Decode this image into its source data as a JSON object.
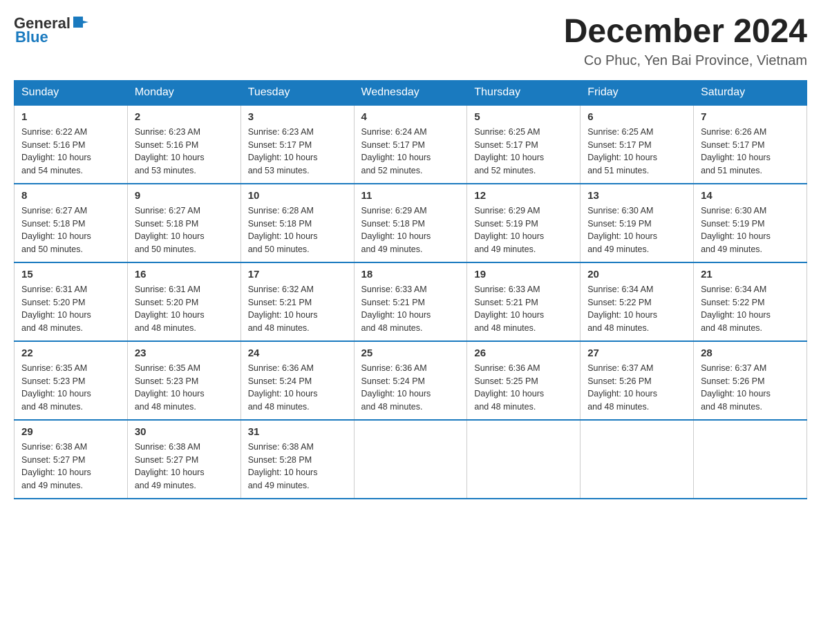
{
  "header": {
    "logo_general": "General",
    "logo_blue": "Blue",
    "title": "December 2024",
    "location": "Co Phuc, Yen Bai Province, Vietnam"
  },
  "days_of_week": [
    "Sunday",
    "Monday",
    "Tuesday",
    "Wednesday",
    "Thursday",
    "Friday",
    "Saturday"
  ],
  "weeks": [
    [
      {
        "day": "1",
        "sunrise": "6:22 AM",
        "sunset": "5:16 PM",
        "daylight": "10 hours and 54 minutes."
      },
      {
        "day": "2",
        "sunrise": "6:23 AM",
        "sunset": "5:16 PM",
        "daylight": "10 hours and 53 minutes."
      },
      {
        "day": "3",
        "sunrise": "6:23 AM",
        "sunset": "5:17 PM",
        "daylight": "10 hours and 53 minutes."
      },
      {
        "day": "4",
        "sunrise": "6:24 AM",
        "sunset": "5:17 PM",
        "daylight": "10 hours and 52 minutes."
      },
      {
        "day": "5",
        "sunrise": "6:25 AM",
        "sunset": "5:17 PM",
        "daylight": "10 hours and 52 minutes."
      },
      {
        "day": "6",
        "sunrise": "6:25 AM",
        "sunset": "5:17 PM",
        "daylight": "10 hours and 51 minutes."
      },
      {
        "day": "7",
        "sunrise": "6:26 AM",
        "sunset": "5:17 PM",
        "daylight": "10 hours and 51 minutes."
      }
    ],
    [
      {
        "day": "8",
        "sunrise": "6:27 AM",
        "sunset": "5:18 PM",
        "daylight": "10 hours and 50 minutes."
      },
      {
        "day": "9",
        "sunrise": "6:27 AM",
        "sunset": "5:18 PM",
        "daylight": "10 hours and 50 minutes."
      },
      {
        "day": "10",
        "sunrise": "6:28 AM",
        "sunset": "5:18 PM",
        "daylight": "10 hours and 50 minutes."
      },
      {
        "day": "11",
        "sunrise": "6:29 AM",
        "sunset": "5:18 PM",
        "daylight": "10 hours and 49 minutes."
      },
      {
        "day": "12",
        "sunrise": "6:29 AM",
        "sunset": "5:19 PM",
        "daylight": "10 hours and 49 minutes."
      },
      {
        "day": "13",
        "sunrise": "6:30 AM",
        "sunset": "5:19 PM",
        "daylight": "10 hours and 49 minutes."
      },
      {
        "day": "14",
        "sunrise": "6:30 AM",
        "sunset": "5:19 PM",
        "daylight": "10 hours and 49 minutes."
      }
    ],
    [
      {
        "day": "15",
        "sunrise": "6:31 AM",
        "sunset": "5:20 PM",
        "daylight": "10 hours and 48 minutes."
      },
      {
        "day": "16",
        "sunrise": "6:31 AM",
        "sunset": "5:20 PM",
        "daylight": "10 hours and 48 minutes."
      },
      {
        "day": "17",
        "sunrise": "6:32 AM",
        "sunset": "5:21 PM",
        "daylight": "10 hours and 48 minutes."
      },
      {
        "day": "18",
        "sunrise": "6:33 AM",
        "sunset": "5:21 PM",
        "daylight": "10 hours and 48 minutes."
      },
      {
        "day": "19",
        "sunrise": "6:33 AM",
        "sunset": "5:21 PM",
        "daylight": "10 hours and 48 minutes."
      },
      {
        "day": "20",
        "sunrise": "6:34 AM",
        "sunset": "5:22 PM",
        "daylight": "10 hours and 48 minutes."
      },
      {
        "day": "21",
        "sunrise": "6:34 AM",
        "sunset": "5:22 PM",
        "daylight": "10 hours and 48 minutes."
      }
    ],
    [
      {
        "day": "22",
        "sunrise": "6:35 AM",
        "sunset": "5:23 PM",
        "daylight": "10 hours and 48 minutes."
      },
      {
        "day": "23",
        "sunrise": "6:35 AM",
        "sunset": "5:23 PM",
        "daylight": "10 hours and 48 minutes."
      },
      {
        "day": "24",
        "sunrise": "6:36 AM",
        "sunset": "5:24 PM",
        "daylight": "10 hours and 48 minutes."
      },
      {
        "day": "25",
        "sunrise": "6:36 AM",
        "sunset": "5:24 PM",
        "daylight": "10 hours and 48 minutes."
      },
      {
        "day": "26",
        "sunrise": "6:36 AM",
        "sunset": "5:25 PM",
        "daylight": "10 hours and 48 minutes."
      },
      {
        "day": "27",
        "sunrise": "6:37 AM",
        "sunset": "5:26 PM",
        "daylight": "10 hours and 48 minutes."
      },
      {
        "day": "28",
        "sunrise": "6:37 AM",
        "sunset": "5:26 PM",
        "daylight": "10 hours and 48 minutes."
      }
    ],
    [
      {
        "day": "29",
        "sunrise": "6:38 AM",
        "sunset": "5:27 PM",
        "daylight": "10 hours and 49 minutes."
      },
      {
        "day": "30",
        "sunrise": "6:38 AM",
        "sunset": "5:27 PM",
        "daylight": "10 hours and 49 minutes."
      },
      {
        "day": "31",
        "sunrise": "6:38 AM",
        "sunset": "5:28 PM",
        "daylight": "10 hours and 49 minutes."
      },
      null,
      null,
      null,
      null
    ]
  ],
  "labels": {
    "sunrise": "Sunrise:",
    "sunset": "Sunset:",
    "daylight": "Daylight:"
  }
}
